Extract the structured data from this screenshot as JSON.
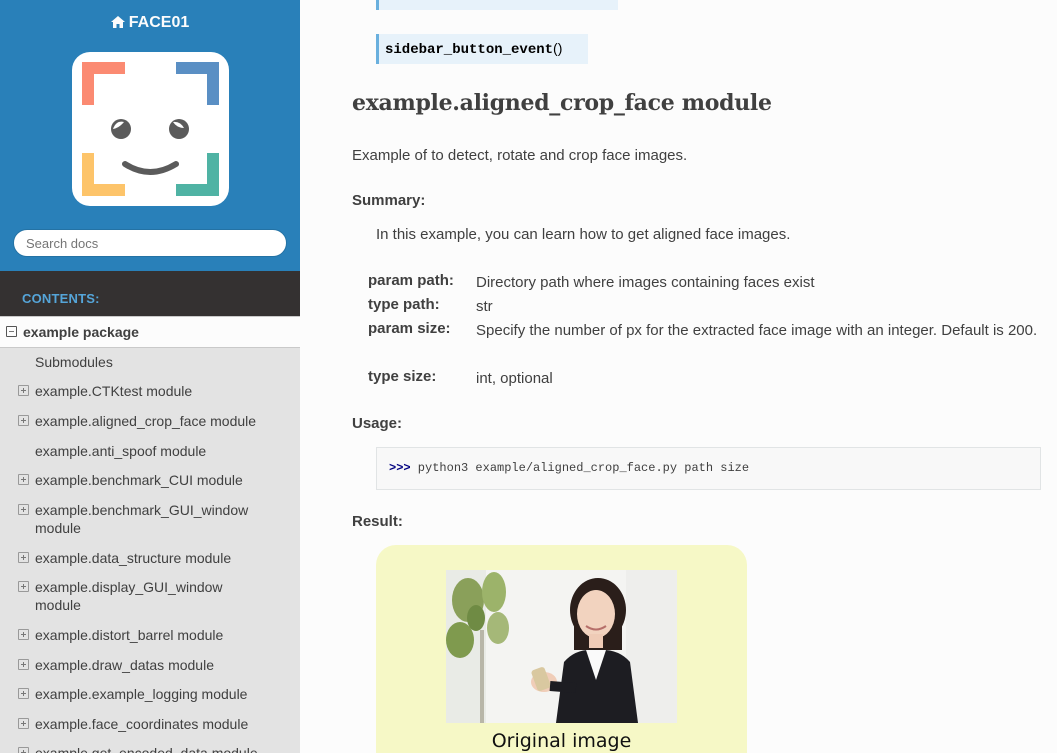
{
  "sidebar": {
    "project_name": "FACE01",
    "search_placeholder": "Search docs",
    "caption": "CONTENTS:",
    "current": "example package",
    "items": [
      {
        "label": "Submodules",
        "toggle": "none"
      },
      {
        "label": "example.CTKtest module",
        "toggle": "plus"
      },
      {
        "label": "example.aligned_crop_face module",
        "toggle": "plus"
      },
      {
        "label": "example.anti_spoof module",
        "toggle": "none"
      },
      {
        "label": "example.benchmark_CUI module",
        "toggle": "plus"
      },
      {
        "label": "example.benchmark_GUI_window module",
        "toggle": "plus"
      },
      {
        "label": "example.data_structure module",
        "toggle": "plus"
      },
      {
        "label": "example.display_GUI_window module",
        "toggle": "plus"
      },
      {
        "label": "example.distort_barrel module",
        "toggle": "plus"
      },
      {
        "label": "example.draw_datas module",
        "toggle": "plus"
      },
      {
        "label": "example.example_logging module",
        "toggle": "plus"
      },
      {
        "label": "example.face_coordinates module",
        "toggle": "plus"
      },
      {
        "label": "example.get_encoded_data module",
        "toggle": "plus"
      }
    ]
  },
  "main": {
    "signature": "sidebar_button_event",
    "signature_parens": "()",
    "heading": "example.aligned_crop_face module",
    "intro": "Example of to detect, rotate and crop face images.",
    "summary_label": "Summary:",
    "summary_text": "In this example, you can learn how to get aligned face images.",
    "fields": [
      {
        "name": "param path:",
        "body": "Directory path where images containing faces exist"
      },
      {
        "name": "type path:",
        "body": "str"
      },
      {
        "name": "param size:",
        "body": "Specify the number of px for the extracted face image with an integer. Default is 200."
      },
      {
        "name": "type size:",
        "body": "int, optional"
      }
    ],
    "usage_label": "Usage:",
    "usage_prompt": ">>>",
    "usage_code": " python3 example/aligned_crop_face.py path size",
    "result_label": "Result:",
    "image_caption": "Original image"
  },
  "colors": {
    "sidebar_top": "#2980b9",
    "sidebar_dark": "#343131",
    "nav_bg": "#e3e3e3",
    "caption": "#55a5d9",
    "signature_bg": "#e7f2fa",
    "result_bg": "#f6f8c6"
  }
}
